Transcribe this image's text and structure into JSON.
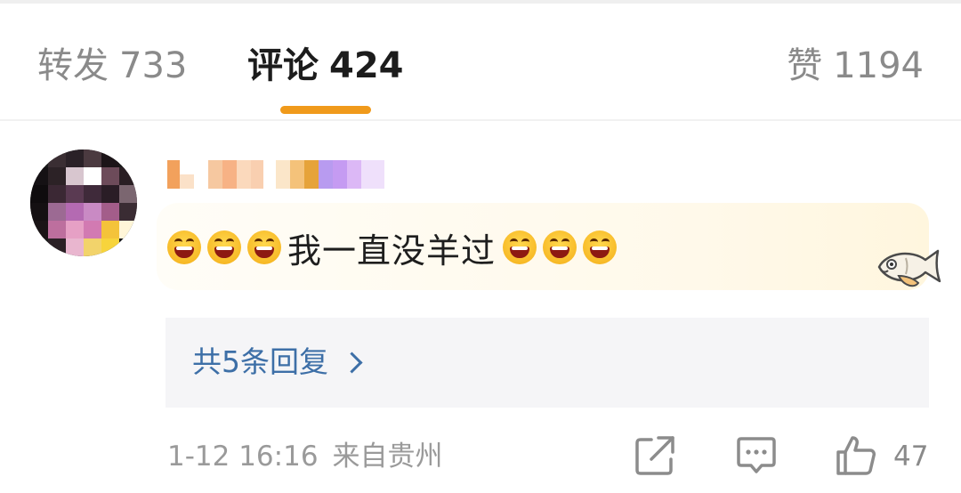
{
  "tabs": {
    "repost": {
      "label": "转发",
      "count": "733"
    },
    "comments": {
      "label": "评论",
      "count": "424"
    },
    "likes": {
      "label": "赞",
      "count": "1194"
    }
  },
  "comment": {
    "text": "我一直没羊过",
    "emoji_icon": "laughing-face-icon",
    "username_obscured": true,
    "avatar_obscured": true,
    "decoration_icon": "fish-sticker-icon"
  },
  "replies": {
    "label": "共5条回复",
    "chevron_icon": "chevron-right-icon"
  },
  "meta": {
    "time": "1-12 16:16",
    "source": "来自贵州"
  },
  "actions": {
    "share_icon": "share-icon",
    "comment_icon": "comment-icon",
    "like_icon": "thumbs-up-icon",
    "like_count": "47"
  },
  "colors": {
    "accent": "#f09a1b",
    "link": "#3d6fa7",
    "muted_text": "#9a9a9a",
    "reply_bg": "#f5f5f7"
  }
}
